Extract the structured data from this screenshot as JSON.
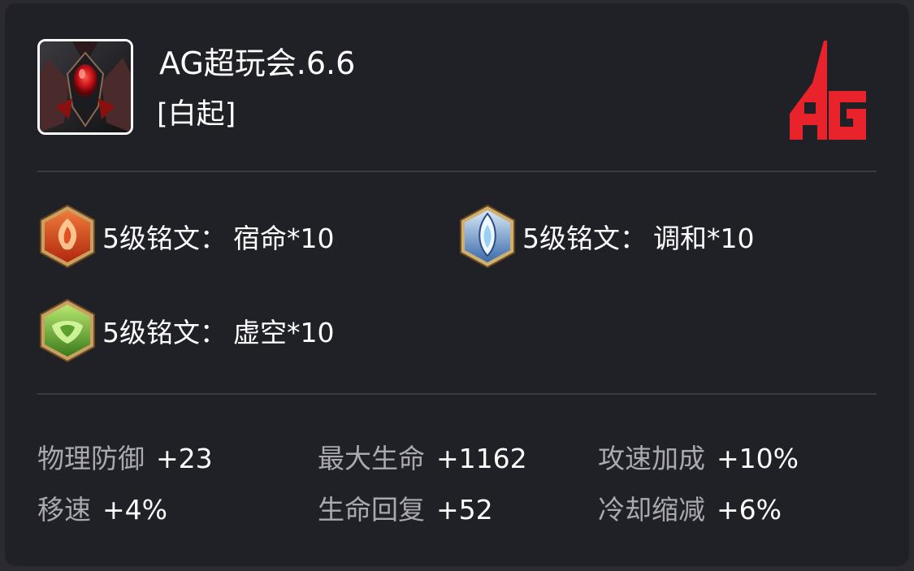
{
  "player": {
    "name": "AG超玩会.6.6",
    "hero": "[白起]"
  },
  "team_logo_text": "AG",
  "colors": {
    "card_bg": "#202027",
    "logo_red": "#e8232c",
    "stat_label": "#a9a9ae",
    "text": "#ffffff"
  },
  "runes": [
    {
      "level": "5级铭文",
      "colon": "：",
      "name": "宿命*10",
      "icon": "red-rune-icon"
    },
    {
      "level": "5级铭文",
      "colon": "：",
      "name": "调和*10",
      "icon": "blue-rune-icon"
    },
    {
      "level": "5级铭文",
      "colon": "：",
      "name": "虚空*10",
      "icon": "green-rune-icon"
    }
  ],
  "stats": [
    {
      "label": "物理防御",
      "value": "+23"
    },
    {
      "label": "最大生命",
      "value": "+1162"
    },
    {
      "label": "攻速加成",
      "value": "+10%"
    },
    {
      "label": "移速",
      "value": "+4%"
    },
    {
      "label": "生命回复",
      "value": "+52"
    },
    {
      "label": "冷却缩减",
      "value": "+6%"
    }
  ]
}
